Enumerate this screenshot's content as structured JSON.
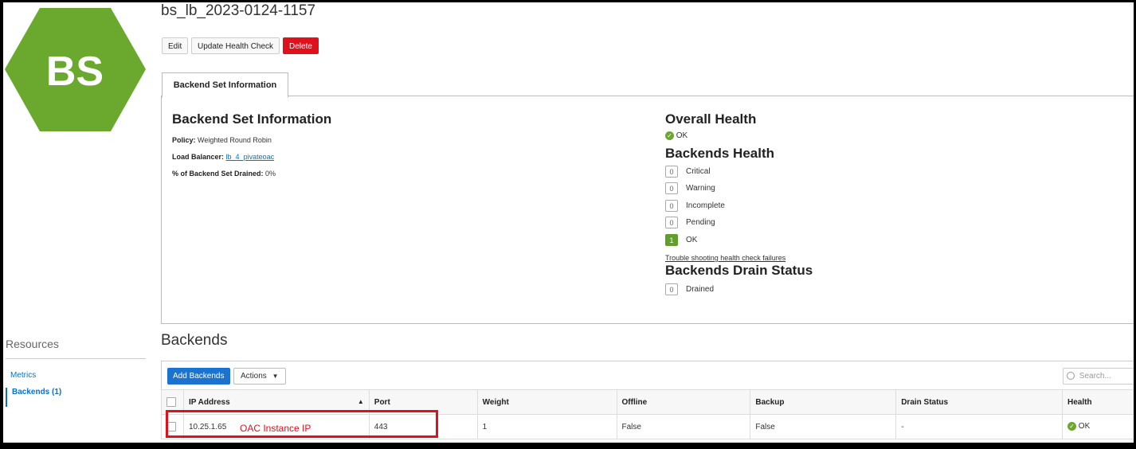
{
  "logo": {
    "text": "BS",
    "color": "#6aa82e"
  },
  "page": {
    "title": "bs_lb_2023-0124-1157"
  },
  "actions": {
    "edit": "Edit",
    "update_health": "Update Health Check",
    "delete": "Delete"
  },
  "tab": {
    "label": "Backend Set Information"
  },
  "info": {
    "heading": "Backend Set Information",
    "policy_label": "Policy:",
    "policy_value": "Weighted Round Robin",
    "lb_label": "Load Balancer:",
    "lb_value": "lb_4_pivateoac",
    "drained_label": "% of Backend Set Drained:",
    "drained_value": "0%"
  },
  "health": {
    "overall_heading": "Overall Health",
    "overall_status": "OK",
    "backends_heading": "Backends Health",
    "rows": [
      {
        "count": "0",
        "label": "Critical"
      },
      {
        "count": "0",
        "label": "Warning"
      },
      {
        "count": "0",
        "label": "Incomplete"
      },
      {
        "count": "0",
        "label": "Pending"
      },
      {
        "count": "1",
        "label": "OK"
      }
    ],
    "troubleshoot_link": "Trouble shooting health check failures",
    "drain_heading": "Backends Drain Status",
    "drain_count": "0",
    "drain_label": "Drained"
  },
  "resources": {
    "heading": "Resources",
    "metrics": "Metrics",
    "backends": "Backends (1)"
  },
  "backends": {
    "heading": "Backends",
    "add_button": "Add Backends",
    "actions_button": "Actions",
    "search_placeholder": "Search...",
    "columns": [
      "IP Address",
      "Port",
      "Weight",
      "Offline",
      "Backup",
      "Drain Status",
      "Health"
    ],
    "row": {
      "ip": "10.25.1.65",
      "port": "443",
      "weight": "1",
      "offline": "False",
      "backup": "False",
      "drain": "-",
      "health": "OK"
    }
  },
  "annotation": {
    "text": "OAC Instance IP",
    "color": "#e0101d"
  }
}
